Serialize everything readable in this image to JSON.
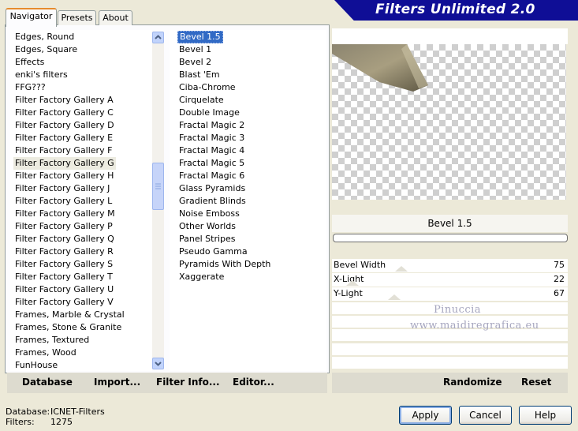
{
  "app": {
    "title": "Filters Unlimited 2.0"
  },
  "tabs": [
    {
      "label": "Navigator",
      "active": true
    },
    {
      "label": "Presets",
      "active": false
    },
    {
      "label": "About",
      "active": false
    }
  ],
  "categories": [
    "Edges, Round",
    "Edges, Square",
    "Effects",
    "enki's filters",
    "FFG???",
    "Filter Factory Gallery A",
    "Filter Factory Gallery C",
    "Filter Factory Gallery D",
    "Filter Factory Gallery E",
    "Filter Factory Gallery F",
    "Filter Factory Gallery G",
    "Filter Factory Gallery H",
    "Filter Factory Gallery J",
    "Filter Factory Gallery L",
    "Filter Factory Gallery M",
    "Filter Factory Gallery P",
    "Filter Factory Gallery Q",
    "Filter Factory Gallery R",
    "Filter Factory Gallery S",
    "Filter Factory Gallery T",
    "Filter Factory Gallery U",
    "Filter Factory Gallery V",
    "Frames, Marble & Crystal",
    "Frames, Stone & Granite",
    "Frames, Textured",
    "Frames, Wood",
    "FunHouse"
  ],
  "selected_category_index": 10,
  "filters": [
    "Bevel 1.5",
    "Bevel 1",
    "Bevel 2",
    "Blast 'Em",
    "Ciba-Chrome",
    "Cirquelate",
    "Double Image",
    "Fractal Magic 2",
    "Fractal Magic 3",
    "Fractal Magic 4",
    "Fractal Magic 5",
    "Fractal Magic 6",
    "Glass Pyramids",
    "Gradient Blinds",
    "Noise Emboss",
    "Other Worlds",
    "Panel Stripes",
    "Pseudo Gamma",
    "Pyramids With Depth",
    "Xaggerate"
  ],
  "selected_filter_index": 0,
  "preview": {
    "filter_name": "Bevel 1.5",
    "progress": 0
  },
  "sliders": [
    {
      "label": "Bevel Width",
      "value": 75
    },
    {
      "label": "X-Light",
      "value": 22
    },
    {
      "label": "Y-Light",
      "value": 67
    }
  ],
  "watermark": {
    "line1": "Pinuccia",
    "line2": "www.maidiregrafica.eu"
  },
  "left_actions": {
    "database": "Database",
    "import": "Import...",
    "filter_info": "Filter Info...",
    "editor": "Editor..."
  },
  "right_actions": {
    "randomize": "Randomize",
    "reset": "Reset"
  },
  "info": {
    "database_label": "Database:",
    "database_value": "ICNET-Filters",
    "filters_label": "Filters:",
    "filters_value": "1275"
  },
  "dialog": {
    "apply": "Apply",
    "cancel": "Cancel",
    "help": "Help"
  },
  "colors": {
    "banner": "#0f0e96",
    "selection": "#316ac5",
    "face": "#ece9d8"
  }
}
